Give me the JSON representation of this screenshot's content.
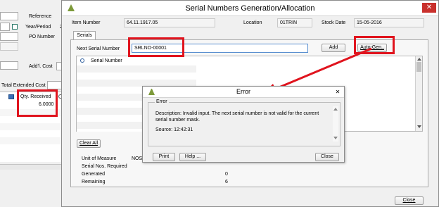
{
  "background_window": {
    "reference_label": "Reference",
    "year_period_label": "Year/Period",
    "year_period_value": "2",
    "po_number_label": "PO Number",
    "addl_cost_label": "Add'l. Cost",
    "total_extended_cost_label": "Total Extended Cost",
    "qty_received_header": "Qty. Received",
    "qty_received_value": "6.0000"
  },
  "serial_dialog": {
    "title": "Serial Numbers Generation/Allocation",
    "item_number_label": "Item Number",
    "item_number_value": "64.11.1917.05",
    "location_label": "Location",
    "location_value": "01TRIN",
    "stock_date_label": "Stock Date",
    "stock_date_value": "15-05-2016",
    "tab_serials": "Serials",
    "next_serial_label": "Next Serial Number",
    "next_serial_value": "SRLNO-00001",
    "add_button": "Add",
    "autogen_button": "Auto-Gen..",
    "serial_column_header": "Serial Number",
    "clear_all_button": "Clear All",
    "unit_of_measure_label": "Unit of Measure",
    "unit_of_measure_value": "NOS",
    "serial_required_label": "Serial Nos. Required",
    "generated_label": "Generated",
    "generated_value": "0",
    "remaining_label": "Remaining",
    "remaining_value": "6",
    "close_button": "Close"
  },
  "error_dialog": {
    "title": "Error",
    "group_label": "Error",
    "description": "Description: Invalid input. The next serial number is not valid for the current serial number mask.",
    "source": "Source:  12:42:31",
    "print_button": "Print",
    "help_button": "Help ...",
    "close_button": "Close"
  },
  "colors": {
    "highlight_red": "#e0141e",
    "window_bg": "#f0f0f0"
  }
}
